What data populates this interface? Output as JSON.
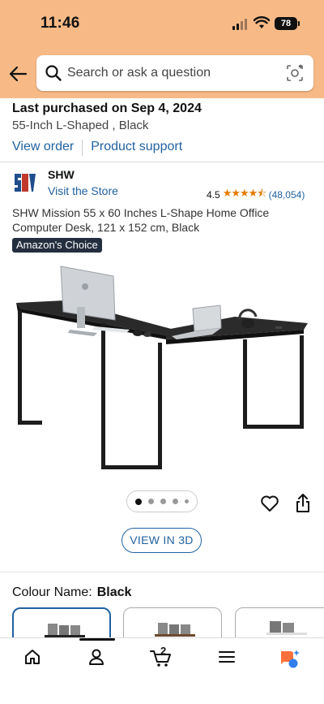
{
  "status": {
    "time": "11:46",
    "battery": "78"
  },
  "search": {
    "placeholder": "Search or ask a question"
  },
  "order": {
    "purchased": "Last purchased on Sep 4, 2024",
    "variant": "55-Inch L-Shaped , Black",
    "view_order": "View order",
    "product_support": "Product support"
  },
  "seller": {
    "name": "SHW",
    "store_link": "Visit the Store"
  },
  "rating": {
    "value": "4.5",
    "stars": "★★★★⯪",
    "count": "(48,054)"
  },
  "product": {
    "title": "SHW Mission 55 x 60 Inches L-Shape Home Office Computer Desk, 121 x 152 cm, Black",
    "badge": "Amazon's Choice"
  },
  "view3d_label": "VIEW IN 3D",
  "colour": {
    "label": "Colour Name:",
    "value": "Black"
  },
  "cart": {
    "count": "2"
  },
  "colors": {
    "accent": "#2162a1",
    "header": "#f7ba87",
    "star": "#e67a00",
    "badge_bg": "#232f3e"
  },
  "icons": [
    "back-arrow-icon",
    "search-icon",
    "camera-lens-icon",
    "heart-icon",
    "share-icon",
    "home-icon",
    "user-icon",
    "cart-icon",
    "menu-icon",
    "rufus-icon"
  ]
}
